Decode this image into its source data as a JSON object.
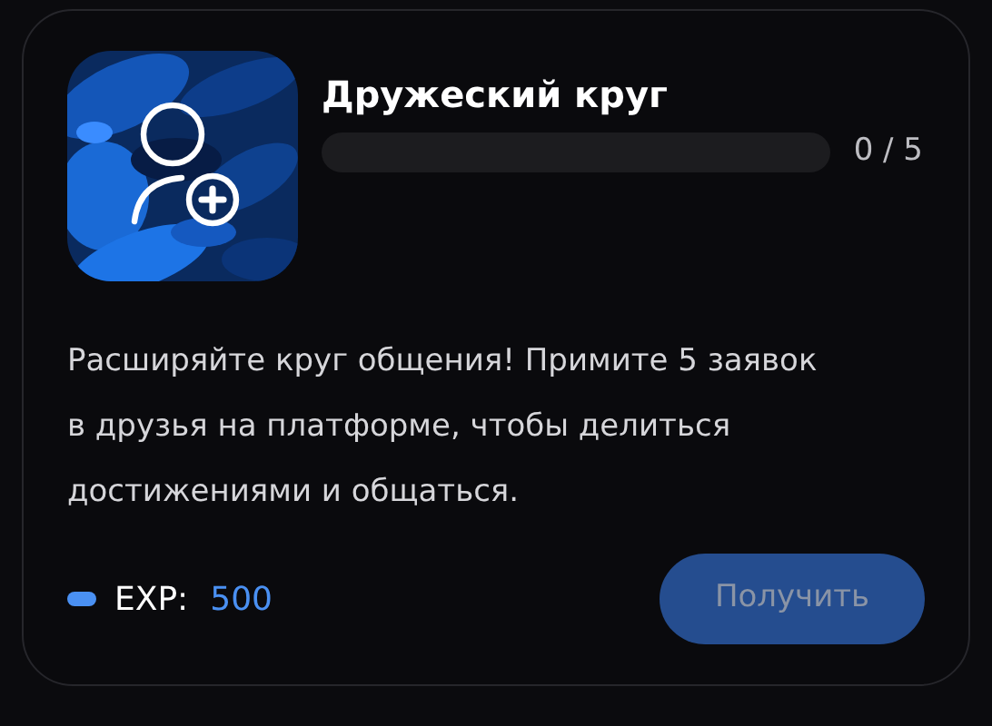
{
  "achievement": {
    "title": "Дружеский круг",
    "progress": {
      "level": 0,
      "reading": "0 / 5"
    },
    "description": "Расширяйте круг общения! Примите 5 заявок в друзья на платформе, чтобы делиться достижениями и общаться.",
    "reward": {
      "label": "EXP:",
      "value": "500"
    },
    "button": {
      "label": "Получить",
      "disabled": true
    }
  }
}
